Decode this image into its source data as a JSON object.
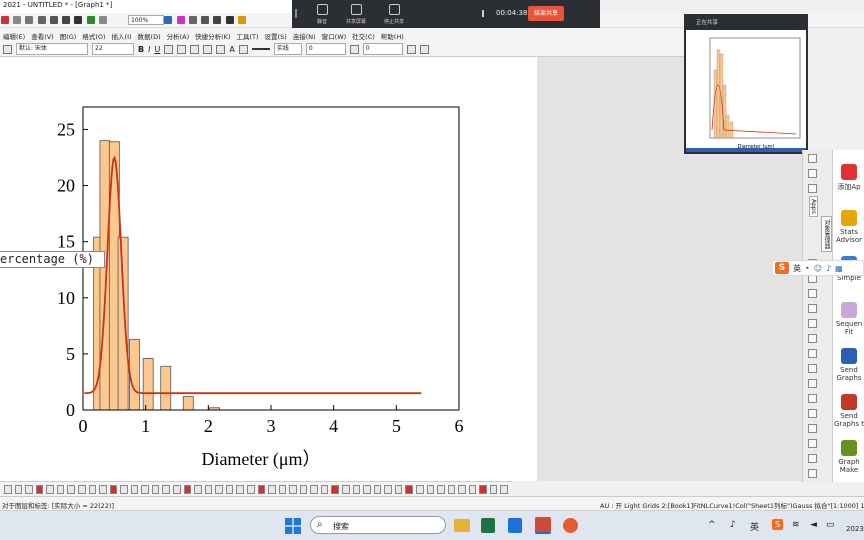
{
  "window": {
    "title": "2021 - UNTITLED * - [Graph1 *]",
    "zoom": "100%"
  },
  "menu": [
    "编辑(E)",
    "查看(V)",
    "图(G)",
    "格式(O)",
    "插入(I)",
    "数据(D)",
    "分析(A)",
    "快捷分析(K)",
    "工具(T)",
    "设置(S)",
    "连接(N)",
    "窗口(W)",
    "社交(C)",
    "帮助(H)"
  ],
  "format_toolbar": {
    "font_name": "默认: 宋体",
    "font_size": "22",
    "line_label": "实线",
    "num1": "0",
    "num2": "0"
  },
  "meeting": {
    "mic_label": "静音",
    "share_label": "共享屏幕",
    "stop_share_label": "停止共享",
    "timer": "00:04:38",
    "end_label": "结束共享"
  },
  "preview": {
    "title": "正在共享",
    "xlabel": "Diameter (μm)"
  },
  "legend": {
    "text": "ercentage (%)"
  },
  "apps_panel": {
    "items": [
      {
        "label": "添加Ap",
        "color": "#d33"
      },
      {
        "label": "Stats Advisor",
        "color": "#e8a400"
      },
      {
        "label": "Simple",
        "color": "#3a7bd5"
      },
      {
        "label": "Sequen Fit",
        "color": "#c7a8d8"
      },
      {
        "label": "Send Graphs",
        "color": "#2b5fb3"
      },
      {
        "label": "Send Graphs t",
        "color": "#c0392b"
      },
      {
        "label": "Graph Make",
        "color": "#6b8e23"
      }
    ],
    "vtab1": "Apps",
    "vtab2": "对象管理器"
  },
  "ime": {
    "lang": "英"
  },
  "statusbar": {
    "left": "对于图层和标签: [实际大小 = 22(22)]",
    "right": "AU : 开  Light Grids  2:[Book1]FitNLCurve1!Col(\"Sheet1列标\")Gauss 拟合\"[1:1000]  1:0"
  },
  "taskbar": {
    "search_placeholder": "搜索",
    "tray_lang": "英",
    "year": "2023"
  },
  "colors": {
    "bar_fill": "#fcc890",
    "bar_stroke": "#555555",
    "fit_line": "#cc3311",
    "end_button": "#e9553a"
  },
  "chart_data": {
    "type": "bar",
    "xlabel": "Diameter (μm）",
    "ylabel": "Percentage (%)",
    "xlim": [
      0,
      6
    ],
    "ylim": [
      0,
      27
    ],
    "xticks": [
      0,
      1,
      2,
      3,
      4,
      5,
      6
    ],
    "yticks": [
      0,
      5,
      10,
      15,
      20,
      25
    ],
    "bin_width": 0.16,
    "bars": [
      {
        "x": 0.25,
        "y": 15.4
      },
      {
        "x": 0.35,
        "y": 24.0
      },
      {
        "x": 0.5,
        "y": 23.9
      },
      {
        "x": 0.64,
        "y": 15.4
      },
      {
        "x": 0.82,
        "y": 6.3
      },
      {
        "x": 1.04,
        "y": 4.6
      },
      {
        "x": 1.32,
        "y": 3.9
      },
      {
        "x": 1.68,
        "y": 1.2
      },
      {
        "x": 2.1,
        "y": 0.2
      }
    ],
    "fit": {
      "type": "gauss",
      "y0": 1.5,
      "xc": 0.5,
      "w": 0.22,
      "peak": 22.5,
      "x_range": [
        0.02,
        5.4
      ]
    }
  }
}
